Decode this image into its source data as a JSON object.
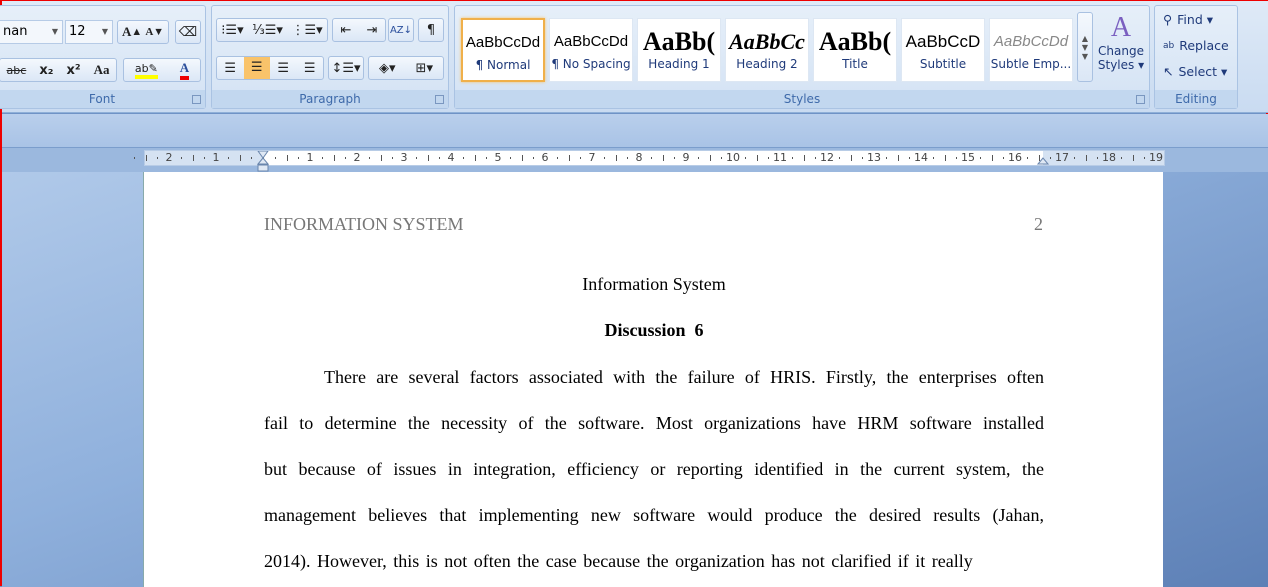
{
  "ribbon": {
    "font": {
      "label": "Font",
      "font_name": "nan",
      "font_size": "12",
      "grow": "A",
      "shrink": "A",
      "strike": "abc",
      "subscript": "x₂",
      "superscript": "x²",
      "change_case": "Aa",
      "font_color": "A",
      "highlight_color": "#ffff00",
      "font_color_hex": "#e00000"
    },
    "paragraph": {
      "label": "Paragraph",
      "show_marks": "¶"
    },
    "styles": {
      "label": "Styles",
      "items": [
        {
          "sample": "AaBbCcDd",
          "name": "¶ Normal"
        },
        {
          "sample": "AaBbCcDd",
          "name": "¶ No Spacing"
        },
        {
          "sample": "AaBb(",
          "name": "Heading 1"
        },
        {
          "sample": "AaBbCc",
          "name": "Heading 2"
        },
        {
          "sample": "AaBb(",
          "name": "Title"
        },
        {
          "sample": "AaBbCcD",
          "name": "Subtitle"
        },
        {
          "sample": "AaBbCcDd",
          "name": "Subtle Emp..."
        }
      ],
      "change_styles_1": "Change",
      "change_styles_2": "Styles ▾"
    },
    "editing": {
      "label": "Editing",
      "find": "Find ▾",
      "replace": "Replace",
      "select": "Select ▾"
    }
  },
  "ruler": {
    "labels": [
      "2",
      "1",
      "1",
      "2",
      "3",
      "4",
      "5",
      "6",
      "7",
      "8",
      "9",
      "10",
      "11",
      "12",
      "13",
      "14",
      "15",
      "16",
      "17",
      "18",
      "19"
    ]
  },
  "document": {
    "header_text": "INFORMATION SYSTEM",
    "page_number": "2",
    "title": "Information System",
    "subtitle": "Discussion  6",
    "lines": [
      "There are several factors associated with the failure of HRIS. Firstly, the enterprises often",
      "fail to determine the necessity of the software. Most organizations have HRM software installed",
      "but because of issues in integration, efficiency or reporting identified in the current system, the",
      "management believes that implementing new software would produce the desired results (Jahan,",
      "2014). However, this is not often the case because the organization has not clarified if it really"
    ]
  }
}
